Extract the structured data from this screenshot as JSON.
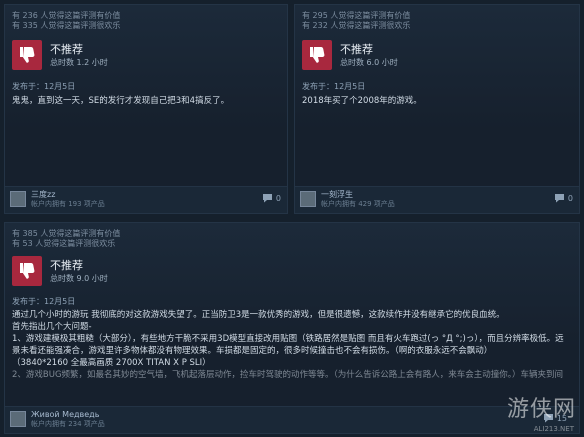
{
  "reviews": [
    {
      "helpful": "有 236 人觉得这篇评测有价值",
      "funny": "有 335 人觉得这篇评测很欢乐",
      "verdict": "不推荐",
      "hours": "总时数 1.2 小时",
      "posted": "发布于：12月5日",
      "text": "鬼鬼，直到这一天，SE的发行才发现自己把3和4搞反了。",
      "user": "三度zz",
      "products": "帐户内拥有 193 项产品",
      "comments": "0"
    },
    {
      "helpful": "有 295 人觉得这篇评测有价值",
      "funny": "有 232 人觉得这篇评测很欢乐",
      "verdict": "不推荐",
      "hours": "总时数 6.0 小时",
      "posted": "发布于：12月5日",
      "text": "2018年买了个2008年的游戏。",
      "user": "一刻浮生",
      "products": "帐户内拥有 429 项产品",
      "comments": "0"
    },
    {
      "helpful": "有 385 人觉得这篇评测有价值",
      "funny": "有 53 人觉得这篇评测很欢乐",
      "verdict": "不推荐",
      "hours": "总时数 9.0 小时",
      "posted": "发布于：12月5日",
      "lines": [
        "通过几个小时的游玩 我彻底的对这款游戏失望了。正当防卫3是一款优秀的游戏，但是很遗憾，这款续作并没有继承它的优良血统。",
        "首先指出几个大问题-",
        "1、游戏建模极其粗糙（大部分），有些地方干脆不采用3D模型直接改用贴图（铁路居然是贴图 而且有火车跑过(っ °Д °;)っ），而且分辨率极低。远",
        "景未看还能强凑合，游戏里许多物体都没有物理效果。车损都是固定的，很多时候撞击也不会有损伤。（啊的衣服永远不会飘动）",
        "（3840*2160 全最高画质 2700X TITAN X P SLI）",
        "2、游戏BUG频繁，如最名其妙的空气墙，飞机起落层动作，捡车时驾驶的动作等等。（为什么告诉公路上会有路人，来车会主动撞你。）车辆夹到间"
      ],
      "user": "Живой Медведь",
      "products": "帐户内拥有 234 项产品",
      "comments": "15"
    }
  ],
  "watermark": {
    "title": "游侠网",
    "sub": "ALI213.NET"
  },
  "colors": {
    "thumb_red": "#a8283e",
    "background": "#15202c"
  },
  "icons": {
    "thumb": "thumb-down-icon",
    "comment": "comment-bubble-icon"
  }
}
